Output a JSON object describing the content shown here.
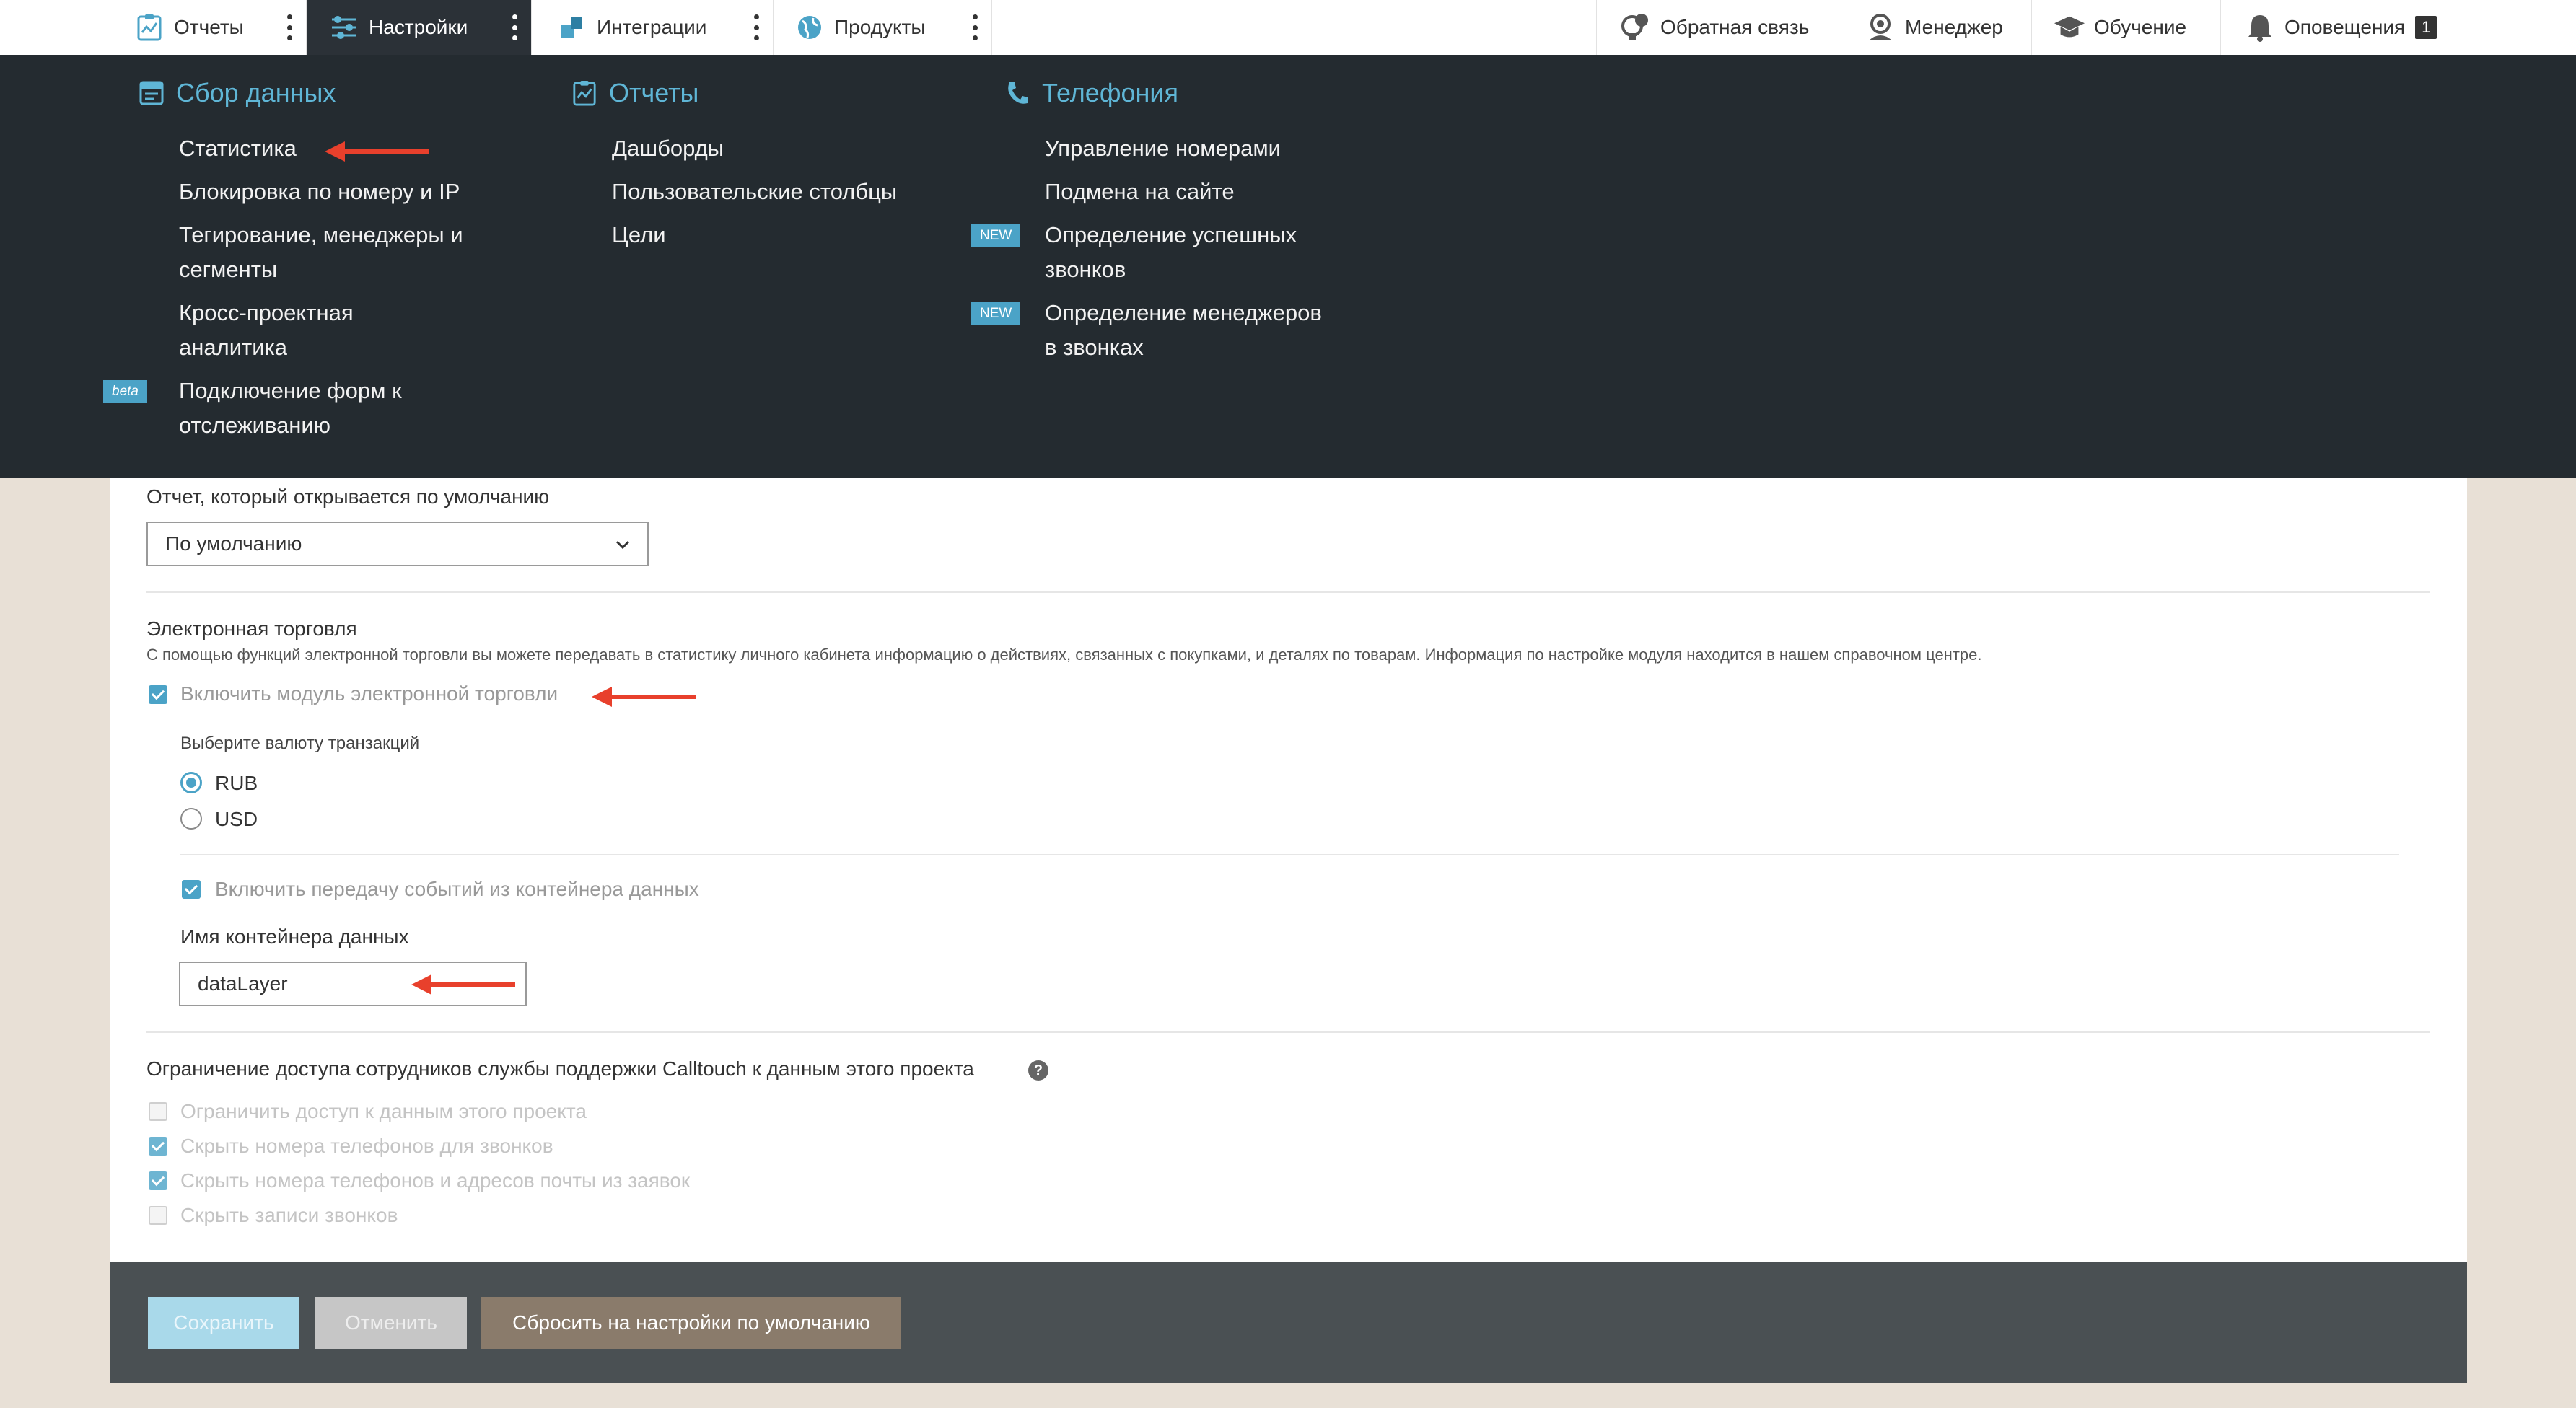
{
  "topnav": {
    "left_tabs": [
      {
        "label": "Отчеты",
        "icon": "report-chart-icon"
      },
      {
        "label": "Настройки",
        "icon": "sliders-icon",
        "active": true
      },
      {
        "label": "Интеграции",
        "icon": "puzzle-icon"
      },
      {
        "label": "Продукты",
        "icon": "globe-icon"
      }
    ],
    "right_tabs": [
      {
        "label": "Обратная связь",
        "icon": "feedback-icon"
      },
      {
        "label": "Менеджер",
        "icon": "manager-icon"
      },
      {
        "label": "Обучение",
        "icon": "graduation-cap-icon"
      },
      {
        "label": "Оповещения",
        "icon": "bell-icon",
        "badge": "1"
      }
    ]
  },
  "mega_menu": {
    "data_collection": {
      "title": "Сбор данных",
      "items": [
        "Статистика",
        "Блокировка по номеру и IP",
        "Тегирование, менеджеры и",
        "сегменты",
        "Кросс-проектная",
        "аналитика",
        "Подключение форм к",
        "отслеживанию"
      ],
      "beta_tag": "beta"
    },
    "reports": {
      "title": "Отчеты",
      "items": [
        "Дашборды",
        "Пользовательские столбцы",
        "Цели"
      ]
    },
    "telephony": {
      "title": "Телефония",
      "items": [
        "Управление номерами",
        "Подмена на сайте",
        "Определение успешных",
        "звонков",
        "Определение менеджеров",
        "в звонках"
      ],
      "new_tag": "NEW"
    }
  },
  "settings": {
    "default_report_label": "Отчет, который открывается по умолчанию",
    "default_report_value": "По умолчанию",
    "ecommerce_title": "Электронная торговля",
    "ecommerce_desc": "С помощью функций электронной торговли вы можете передавать в статистику личного кабинета информацию о действиях, связанных с покупками, и деталях по товарам. Информация по настройке модуля находится в нашем справочном центре.",
    "ecommerce_enable": "Включить модуль электронной торговли",
    "currency_label": "Выберите валюту транзакций",
    "currencies": [
      {
        "label": "RUB",
        "selected": true
      },
      {
        "label": "USD",
        "selected": false
      }
    ],
    "container_events": "Включить передачу событий из контейнера данных",
    "container_name_label": "Имя контейнера данных",
    "container_name_value": "dataLayer",
    "access_title": "Ограничение доступа сотрудников службы поддержки Calltouch к данным этого проекта",
    "help_glyph": "?",
    "access_options": [
      {
        "label": "Ограничить доступ к данным этого проекта",
        "checked": false
      },
      {
        "label": "Скрыть номера телефонов для звонков",
        "checked": true
      },
      {
        "label": "Скрыть номера телефонов и адресов почты из заявок",
        "checked": true
      },
      {
        "label": "Скрыть записи звонков",
        "checked": false
      }
    ]
  },
  "footer": {
    "save": "Сохранить",
    "cancel": "Отменить",
    "reset": "Сбросить на настройки по умолчанию"
  },
  "colors": {
    "accent": "#4ba3c7",
    "menu_bg": "#242b30",
    "annotation_arrow": "#e8402c"
  }
}
